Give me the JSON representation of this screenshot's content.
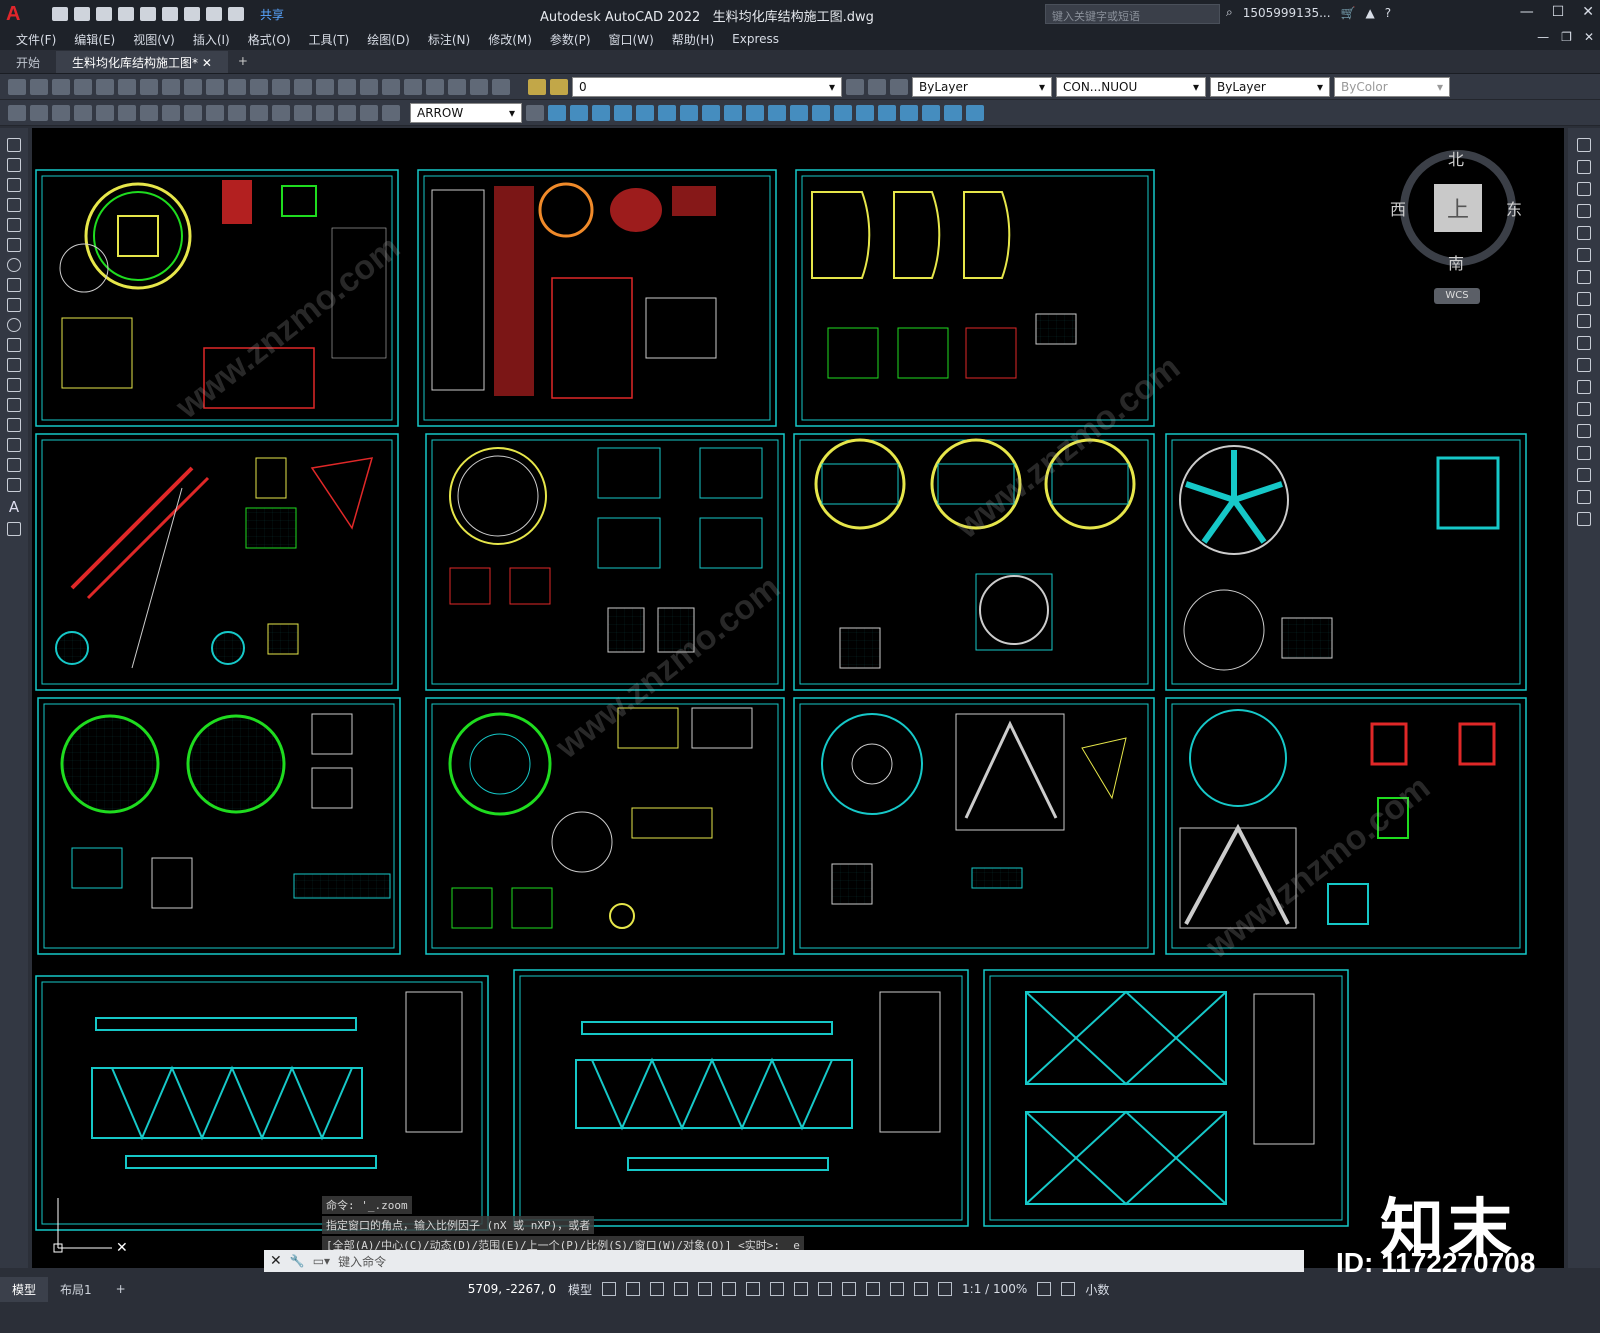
{
  "app": {
    "logo": "A",
    "title": "Autodesk AutoCAD 2022",
    "filename": "生料均化库结构施工图.dwg",
    "share": "共享",
    "search_placeholder": "键入关键字或短语",
    "user": "1505999135...",
    "window_controls": [
      "—",
      "☐",
      "✕"
    ]
  },
  "menu": [
    "文件(F)",
    "编辑(E)",
    "视图(V)",
    "插入(I)",
    "格式(O)",
    "工具(T)",
    "绘图(D)",
    "标注(N)",
    "修改(M)",
    "参数(P)",
    "窗口(W)",
    "帮助(H)",
    "Express"
  ],
  "tabs": [
    {
      "label": "开始",
      "active": false
    },
    {
      "label": "生料均化库结构施工图*",
      "active": true
    },
    {
      "label": "+",
      "active": false
    }
  ],
  "toolbar": {
    "layer": "0",
    "color": "ByLayer",
    "linetype": "CON...NUOU",
    "lineweight": "ByLayer",
    "plotstyle": "ByColor",
    "dimstyle": "ARROW"
  },
  "viewcube": {
    "north": "北",
    "south": "南",
    "west": "西",
    "east": "东",
    "face": "上",
    "wcs": "WCS"
  },
  "command": {
    "history": [
      "命令: '_.zoom",
      "指定窗口的角点，输入比例因子 (nX 或 nXP)，或者",
      "[全部(A)/中心(C)/动态(D)/范围(E)/上一个(P)/比例(S)/窗口(W)/对象(O)] <实时>: _e"
    ],
    "placeholder": "键入命令"
  },
  "status": {
    "model_tab": "模型",
    "layout_tab": "布局1",
    "add": "+",
    "coords": "5709, -2267, 0",
    "space": "模型",
    "scale": "1:1 / 100%",
    "units": "小数"
  },
  "brand": {
    "name": "知末",
    "id": "ID: 1172270708"
  },
  "colors": {
    "sheet_border": "#16c8c8",
    "canvas": "#000000",
    "accent": "#e0262b"
  }
}
